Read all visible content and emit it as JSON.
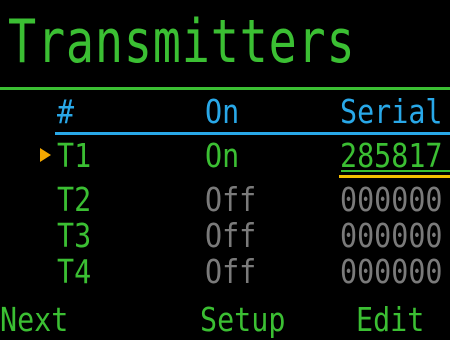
{
  "screen": {
    "title": "Transmitters"
  },
  "table": {
    "columns": [
      "#",
      "On",
      "Serial"
    ],
    "rows": [
      {
        "name": "T1",
        "on": "On",
        "serial": "285817",
        "selected": true
      },
      {
        "name": "T2",
        "on": "Off",
        "serial": "000000",
        "selected": false
      },
      {
        "name": "T3",
        "on": "Off",
        "serial": "000000",
        "selected": false
      },
      {
        "name": "T4",
        "on": "Off",
        "serial": "000000",
        "selected": false
      }
    ]
  },
  "softkeys": {
    "left": "Next",
    "center": "Setup",
    "right": "Edit"
  },
  "icons": {
    "cursor": "selection-arrow-icon"
  },
  "colors": {
    "background": "#000000",
    "primary_green": "#3bbf33",
    "header_blue": "#29a8e8",
    "inactive_gray": "#7a7a7a",
    "selection_orange": "#f5a800",
    "selection_yellow": "#f5c000"
  }
}
